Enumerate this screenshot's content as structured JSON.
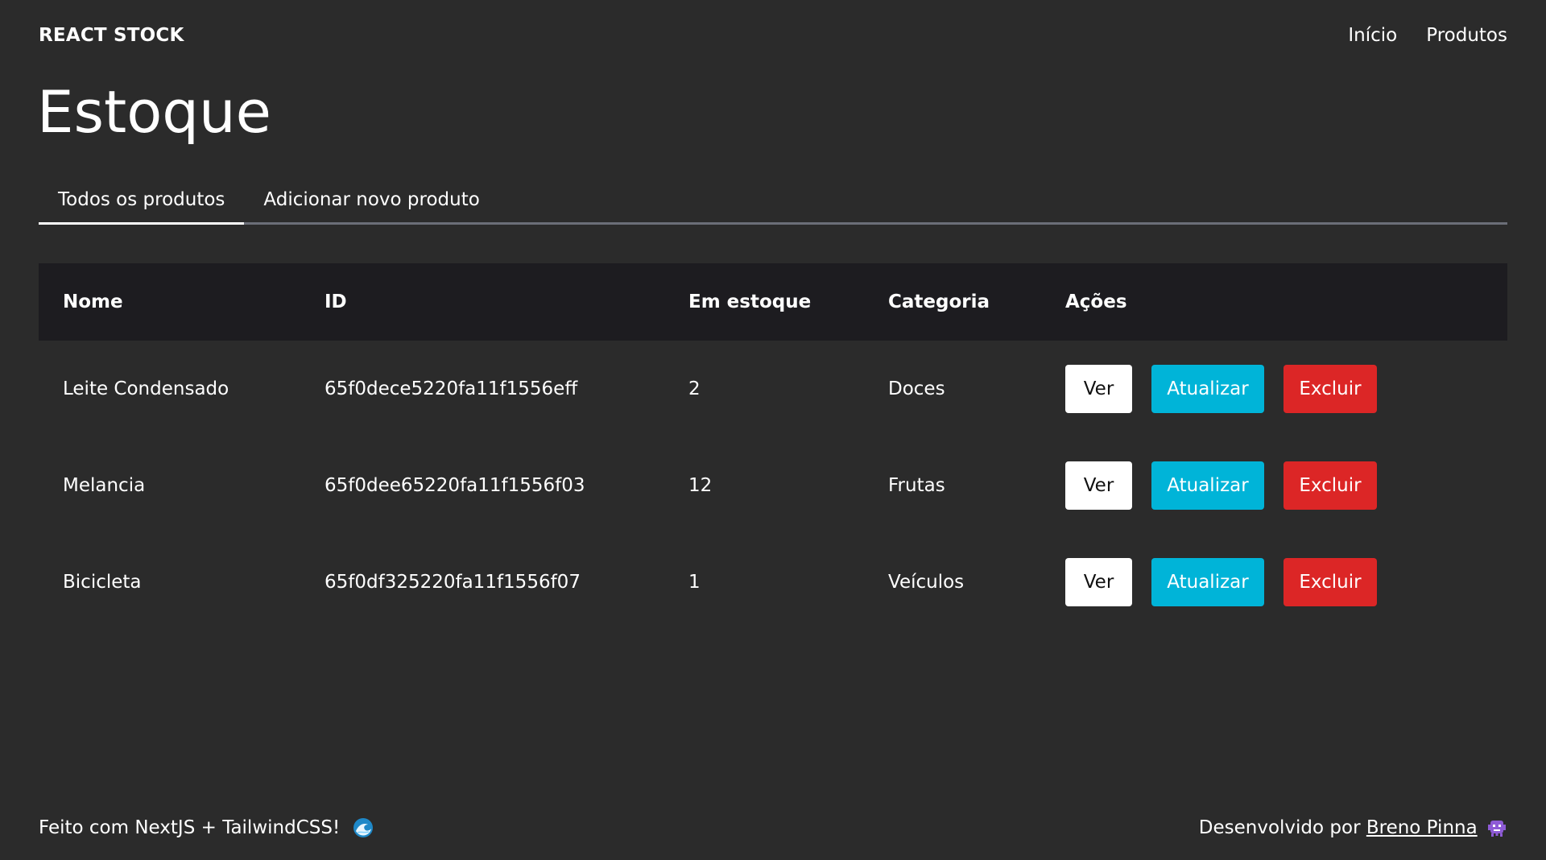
{
  "header": {
    "brand": "REACT STOCK",
    "nav": [
      "Início",
      "Produtos"
    ]
  },
  "page_title": "Estoque",
  "tabs": [
    {
      "label": "Todos os produtos",
      "active": true
    },
    {
      "label": "Adicionar novo produto",
      "active": false
    }
  ],
  "table": {
    "columns": [
      "Nome",
      "ID",
      "Em estoque",
      "Categoria",
      "Ações"
    ],
    "rows": [
      {
        "name": "Leite Condensado",
        "id": "65f0dece5220fa11f1556eff",
        "stock": "2",
        "category": "Doces"
      },
      {
        "name": "Melancia",
        "id": "65f0dee65220fa11f1556f03",
        "stock": "12",
        "category": "Frutas"
      },
      {
        "name": "Bicicleta",
        "id": "65f0df325220fa11f1556f07",
        "stock": "1",
        "category": "Veículos"
      }
    ],
    "actions": {
      "view": "Ver",
      "update": "Atualizar",
      "delete": "Excluir"
    }
  },
  "footer": {
    "left_text": "Feito com NextJS + TailwindCSS!",
    "left_icon": "wave-icon",
    "right_prefix": "Desenvolvido por",
    "right_link": "Breno Pinna",
    "right_icon": "alien-monster-icon"
  },
  "colors": {
    "background": "#2b2b2b",
    "table_header": "#1d1c20",
    "update": "#00b4d8",
    "delete": "#dc2626"
  }
}
